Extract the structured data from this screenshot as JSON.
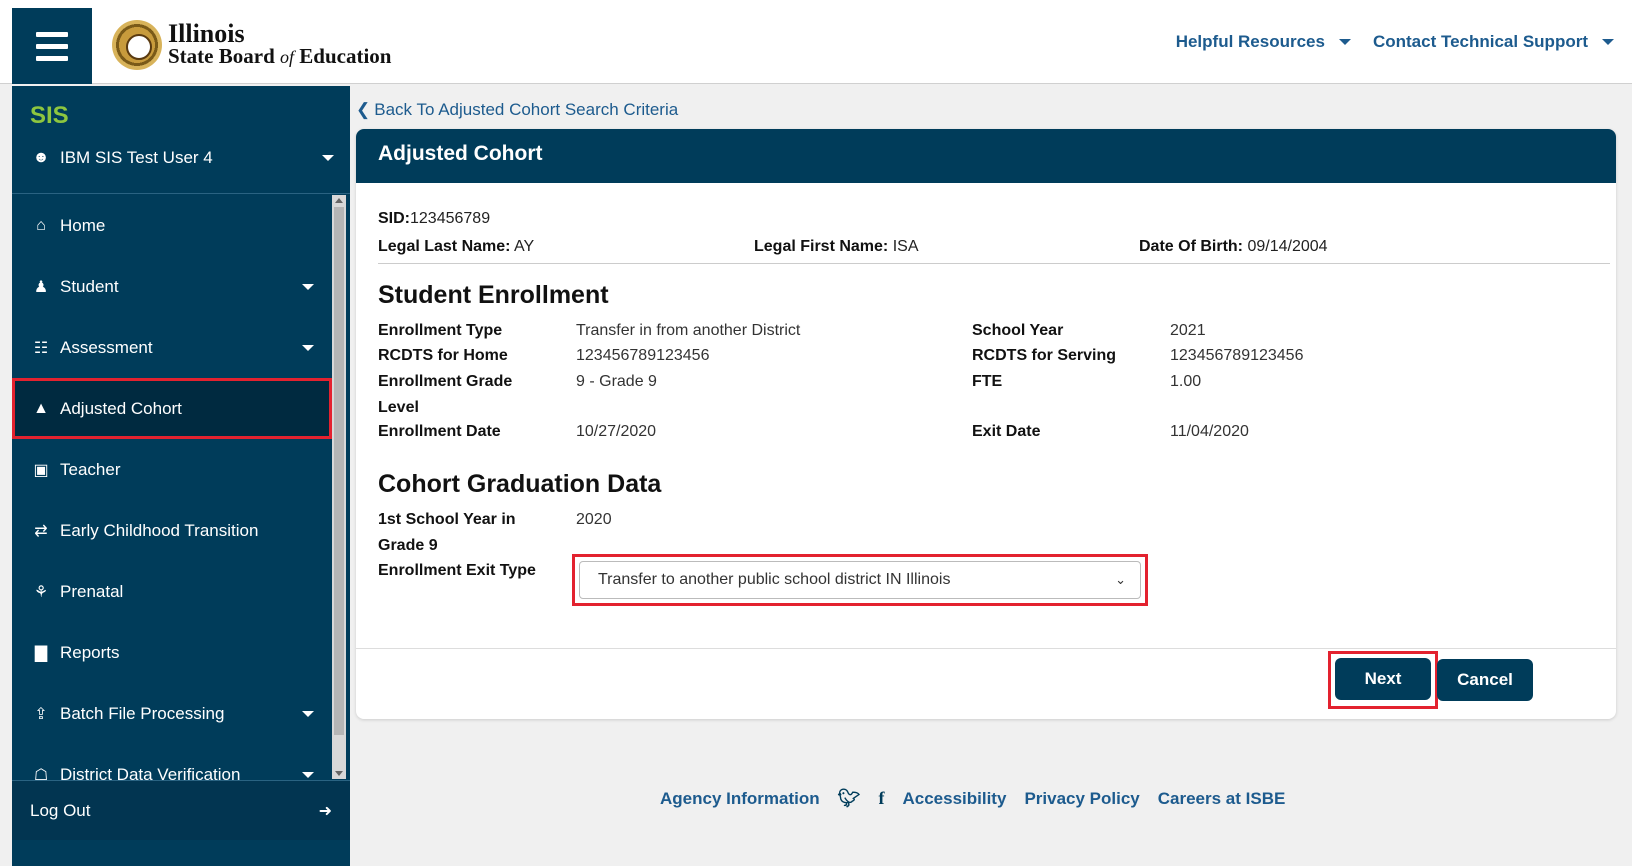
{
  "header": {
    "logo_title": "Illinois",
    "logo_sub_a": "State Board",
    "logo_sub_of": "of",
    "logo_sub_b": "Education",
    "links": [
      "Helpful Resources",
      "Contact Technical Support"
    ]
  },
  "sidebar": {
    "app_title": "SIS",
    "user": "IBM SIS Test User 4",
    "items": [
      {
        "label": "Home",
        "icon": "home-icon",
        "glyph": "⌂",
        "has_caret": false
      },
      {
        "label": "Student",
        "icon": "student-icon",
        "glyph": "♟",
        "has_caret": true
      },
      {
        "label": "Assessment",
        "icon": "document-icon",
        "glyph": "☷",
        "has_caret": true
      },
      {
        "label": "Adjusted Cohort",
        "icon": "graduation-cap-icon",
        "glyph": "▲",
        "has_caret": false,
        "active": true
      },
      {
        "label": "Teacher",
        "icon": "teacher-board-icon",
        "glyph": "▣",
        "has_caret": false
      },
      {
        "label": "Early Childhood Transition",
        "icon": "exchange-icon",
        "glyph": "⇄",
        "has_caret": false
      },
      {
        "label": "Prenatal",
        "icon": "baby-carriage-icon",
        "glyph": "⚘",
        "has_caret": false
      },
      {
        "label": "Reports",
        "icon": "bar-chart-icon",
        "glyph": "▇",
        "has_caret": false
      },
      {
        "label": "Batch File Processing",
        "icon": "upload-icon",
        "glyph": "⇪",
        "has_caret": true
      },
      {
        "label": "District Data Verification",
        "icon": "building-icon",
        "glyph": "☖",
        "has_caret": true
      }
    ],
    "logout": "Log Out"
  },
  "main": {
    "back_link": "Back To Adjusted Cohort Search Criteria",
    "card_title": "Adjusted Cohort",
    "student": {
      "sid_label": "SID:",
      "sid": "123456789",
      "last_name_label": "Legal Last Name:",
      "last_name": "AY",
      "first_name_label": "Legal First Name:",
      "first_name": "ISA",
      "dob_label": "Date Of Birth:",
      "dob": "09/14/2004"
    },
    "enrollment": {
      "title": "Student Enrollment",
      "enrollment_type_label": "Enrollment Type",
      "enrollment_type": "Transfer in from another District",
      "rcdts_home_label": "RCDTS for Home",
      "rcdts_home": "123456789123456",
      "grade_level_label_1": "Enrollment Grade",
      "grade_level_label_2": "Level",
      "grade_level": "9 - Grade 9",
      "enrollment_date_label": "Enrollment Date",
      "enrollment_date": "10/27/2020",
      "school_year_label": "School Year",
      "school_year": "2021",
      "rcdts_serving_label": "RCDTS for Serving",
      "rcdts_serving": "123456789123456",
      "fte_label": "FTE",
      "fte": "1.00",
      "exit_date_label": "Exit Date",
      "exit_date": "11/04/2020"
    },
    "cohort": {
      "title": "Cohort Graduation Data",
      "first_year_label_1": "1st School Year in",
      "first_year_label_2": "Grade 9",
      "first_year": "2020",
      "exit_type_label": "Enrollment Exit Type",
      "exit_type": "Transfer to another public school district IN Illinois"
    },
    "buttons": {
      "next": "Next",
      "cancel": "Cancel"
    }
  },
  "footer": {
    "agency": "Agency Information",
    "accessibility": "Accessibility",
    "privacy": "Privacy Policy",
    "careers": "Careers at ISBE"
  },
  "colors": {
    "navy": "#003c5a",
    "accent_green": "#8dc63f",
    "highlight_red": "#e3222f",
    "link_blue": "#1d5b8e"
  }
}
